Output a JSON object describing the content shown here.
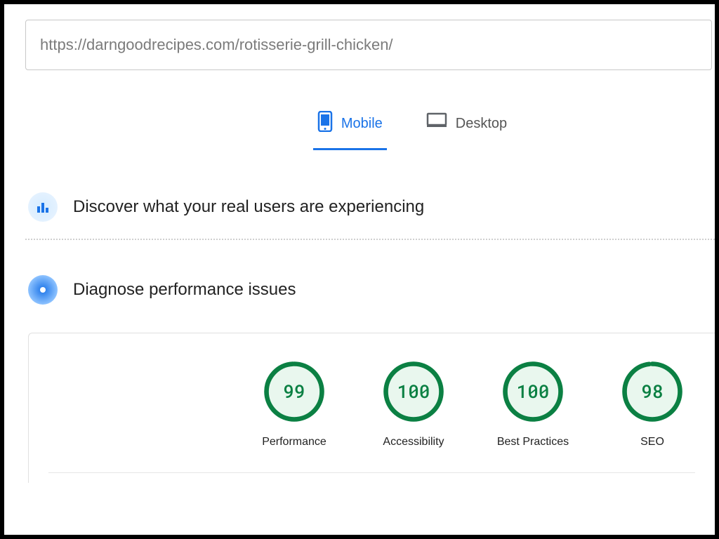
{
  "url": "https://darngoodrecipes.com/rotisserie-grill-chicken/",
  "tabs": {
    "mobile": "Mobile",
    "desktop": "Desktop"
  },
  "sections": {
    "discover": "Discover what your real users are experiencing",
    "diagnose": "Diagnose performance issues"
  },
  "scores": [
    {
      "label": "Performance",
      "value": 99
    },
    {
      "label": "Accessibility",
      "value": 100
    },
    {
      "label": "Best Practices",
      "value": 100
    },
    {
      "label": "SEO",
      "value": 98
    }
  ],
  "colors": {
    "accent": "#1a73e8",
    "good": "#0b8043"
  }
}
